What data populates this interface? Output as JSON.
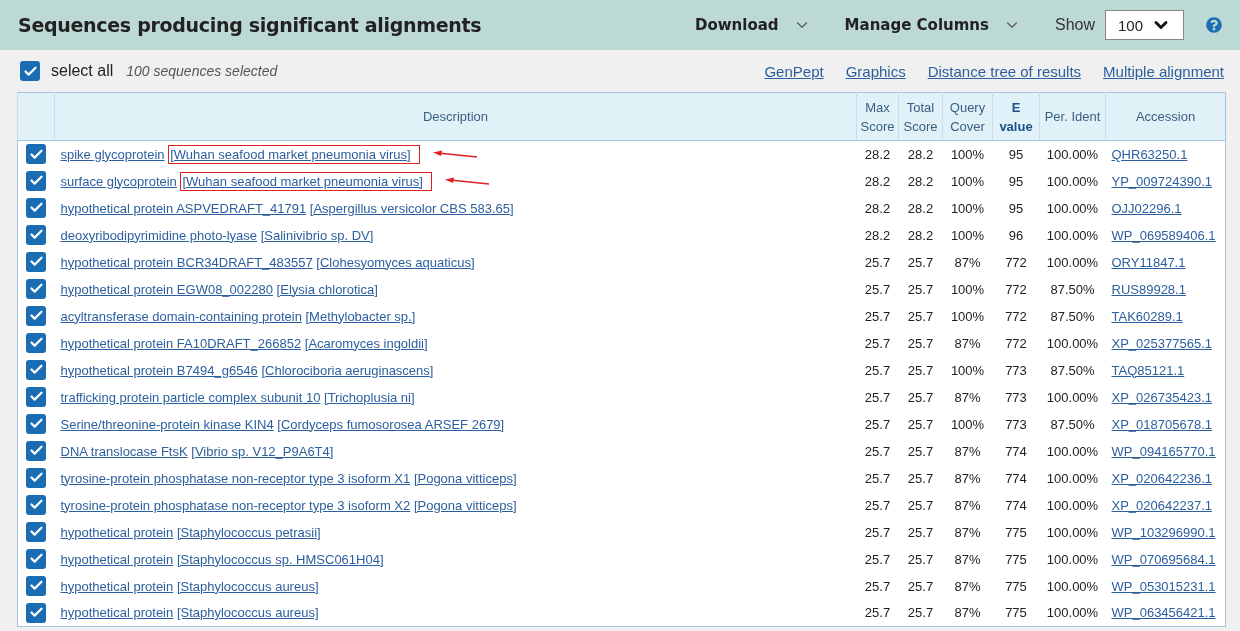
{
  "header": {
    "title": "Sequences producing significant alignments",
    "menus": [
      "Download",
      "Manage Columns"
    ],
    "show_label": "Show",
    "show_value": "100"
  },
  "selection": {
    "checked": true,
    "label": "select all",
    "count": "100 sequences selected"
  },
  "links": [
    "GenPept",
    "Graphics",
    "Distance tree of results",
    "Multiple alignment"
  ],
  "table": {
    "columns": [
      {
        "label": "Description",
        "sorted": false
      },
      {
        "label": "Max Score",
        "sorted": false
      },
      {
        "label": "Total Score",
        "sorted": false
      },
      {
        "label": "Query Cover",
        "sorted": false
      },
      {
        "label": "E value",
        "sorted": true
      },
      {
        "label": "Per. Ident",
        "sorted": false
      },
      {
        "label": "Accession",
        "sorted": false
      }
    ],
    "rows": [
      {
        "checked": true,
        "highlighted": true,
        "name": "spike glycoprotein",
        "organism": "[Wuhan seafood market pneumonia virus]",
        "max": "28.2",
        "total": "28.2",
        "cover": "100%",
        "evalue": "95",
        "ident": "100.00%",
        "accession": "QHR63250.1"
      },
      {
        "checked": true,
        "highlighted": true,
        "name": "surface glycoprotein",
        "organism": "[Wuhan seafood market pneumonia virus]",
        "max": "28.2",
        "total": "28.2",
        "cover": "100%",
        "evalue": "95",
        "ident": "100.00%",
        "accession": "YP_009724390.1"
      },
      {
        "checked": true,
        "highlighted": false,
        "name": "hypothetical protein ASPVEDRAFT_41791",
        "organism": "[Aspergillus versicolor CBS 583.65]",
        "max": "28.2",
        "total": "28.2",
        "cover": "100%",
        "evalue": "95",
        "ident": "100.00%",
        "accession": "OJJ02296.1"
      },
      {
        "checked": true,
        "highlighted": false,
        "name": "deoxyribodipyrimidine photo-lyase",
        "organism": "[Salinivibrio sp. DV]",
        "max": "28.2",
        "total": "28.2",
        "cover": "100%",
        "evalue": "96",
        "ident": "100.00%",
        "accession": "WP_069589406.1"
      },
      {
        "checked": true,
        "highlighted": false,
        "name": "hypothetical protein BCR34DRAFT_483557",
        "organism": "[Clohesyomyces aquaticus]",
        "max": "25.7",
        "total": "25.7",
        "cover": "87%",
        "evalue": "772",
        "ident": "100.00%",
        "accession": "ORY11847.1"
      },
      {
        "checked": true,
        "highlighted": false,
        "name": "hypothetical protein EGW08_002280",
        "organism": "[Elysia chlorotica]",
        "max": "25.7",
        "total": "25.7",
        "cover": "100%",
        "evalue": "772",
        "ident": "87.50%",
        "accession": "RUS89928.1"
      },
      {
        "checked": true,
        "highlighted": false,
        "name": "acyltransferase domain-containing protein",
        "organism": "[Methylobacter sp.]",
        "max": "25.7",
        "total": "25.7",
        "cover": "100%",
        "evalue": "772",
        "ident": "87.50%",
        "accession": "TAK60289.1"
      },
      {
        "checked": true,
        "highlighted": false,
        "name": "hypothetical protein FA10DRAFT_266852",
        "organism": "[Acaromyces ingoldii]",
        "max": "25.7",
        "total": "25.7",
        "cover": "87%",
        "evalue": "772",
        "ident": "100.00%",
        "accession": "XP_025377565.1"
      },
      {
        "checked": true,
        "highlighted": false,
        "name": "hypothetical protein B7494_g6546",
        "organism": "[Chlorociboria aeruginascens]",
        "max": "25.7",
        "total": "25.7",
        "cover": "100%",
        "evalue": "773",
        "ident": "87.50%",
        "accession": "TAQ85121.1"
      },
      {
        "checked": true,
        "highlighted": false,
        "name": "trafficking protein particle complex subunit 10",
        "organism": "[Trichoplusia ni]",
        "max": "25.7",
        "total": "25.7",
        "cover": "87%",
        "evalue": "773",
        "ident": "100.00%",
        "accession": "XP_026735423.1"
      },
      {
        "checked": true,
        "highlighted": false,
        "name": "Serine/threonine-protein kinase KIN4",
        "organism": "[Cordyceps fumosorosea ARSEF 2679]",
        "max": "25.7",
        "total": "25.7",
        "cover": "100%",
        "evalue": "773",
        "ident": "87.50%",
        "accession": "XP_018705678.1"
      },
      {
        "checked": true,
        "highlighted": false,
        "name": "DNA translocase FtsK",
        "organism": "[Vibrio sp. V12_P9A6T4]",
        "max": "25.7",
        "total": "25.7",
        "cover": "87%",
        "evalue": "774",
        "ident": "100.00%",
        "accession": "WP_094165770.1"
      },
      {
        "checked": true,
        "highlighted": false,
        "name": "tyrosine-protein phosphatase non-receptor type 3 isoform X1",
        "organism": "[Pogona vitticeps]",
        "max": "25.7",
        "total": "25.7",
        "cover": "87%",
        "evalue": "774",
        "ident": "100.00%",
        "accession": "XP_020642236.1"
      },
      {
        "checked": true,
        "highlighted": false,
        "name": "tyrosine-protein phosphatase non-receptor type 3 isoform X2",
        "organism": "[Pogona vitticeps]",
        "max": "25.7",
        "total": "25.7",
        "cover": "87%",
        "evalue": "774",
        "ident": "100.00%",
        "accession": "XP_020642237.1"
      },
      {
        "checked": true,
        "highlighted": false,
        "name": "hypothetical protein",
        "organism": "[Staphylococcus petrasii]",
        "max": "25.7",
        "total": "25.7",
        "cover": "87%",
        "evalue": "775",
        "ident": "100.00%",
        "accession": "WP_103296990.1"
      },
      {
        "checked": true,
        "highlighted": false,
        "name": "hypothetical protein",
        "organism": "[Staphylococcus sp. HMSC061H04]",
        "max": "25.7",
        "total": "25.7",
        "cover": "87%",
        "evalue": "775",
        "ident": "100.00%",
        "accession": "WP_070695684.1"
      },
      {
        "checked": true,
        "highlighted": false,
        "name": "hypothetical protein",
        "organism": "[Staphylococcus aureus]",
        "max": "25.7",
        "total": "25.7",
        "cover": "87%",
        "evalue": "775",
        "ident": "100.00%",
        "accession": "WP_053015231.1"
      },
      {
        "checked": true,
        "highlighted": false,
        "name": "hypothetical protein",
        "organism": "[Staphylococcus aureus]",
        "max": "25.7",
        "total": "25.7",
        "cover": "87%",
        "evalue": "775",
        "ident": "100.00%",
        "accession": "WP_063456421.1"
      }
    ]
  }
}
